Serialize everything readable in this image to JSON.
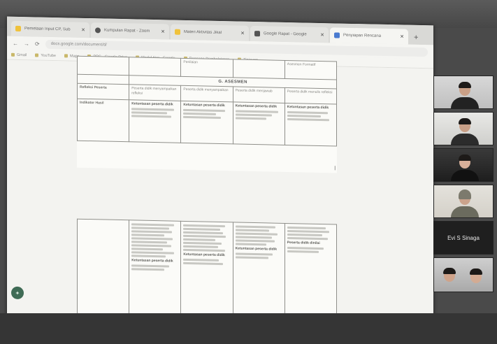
{
  "browser": {
    "tabs": [
      {
        "label": "Pemetaan Input CP, Sub",
        "color": "#f0c23b",
        "active": false
      },
      {
        "label": "Kumpulan Rapat - Zoom",
        "color": "#555555",
        "active": false
      },
      {
        "label": "Materi Aktivitas Jikal",
        "color": "#f0c23b",
        "active": false
      },
      {
        "label": "Google Rapat - Google",
        "color": "#555555",
        "active": false
      },
      {
        "label": "Penyiapan Rencana",
        "color": "#4a7bd0",
        "active": true
      }
    ],
    "new_tab": "+",
    "url": "docs.google.com/document/d/",
    "bookmarks": [
      "Gmail",
      "YouTube",
      "Maps",
      "PPG - Google Drive",
      "Modul Ajar - Google",
      "Rencana Pembelajaran",
      "Tinjauan"
    ]
  },
  "document": {
    "page1": {
      "section_head": "G. ASESMEN",
      "rows": [
        {
          "label": "",
          "cells": [
            "",
            "Penilaian",
            "",
            "",
            "Asesmen Formatif"
          ]
        },
        {
          "label": "Refleksi Peserta",
          "cells": [
            "Peserta didik menyampaikan refleksi",
            "Peserta didik menyampaikan",
            "Peserta didik menjawab",
            "Peserta didik menulis refleksi"
          ]
        },
        {
          "label": "Indikator Hasil",
          "bullet": "Ketuntasan peserta didik",
          "cells": [
            "Peserta didik mampu mengerjakan tugas",
            "Peserta didik mampu menjelaskan konsep",
            "Peserta didik mampu menyelesaikan soal",
            "Peserta didik mampu menyimpulkan"
          ]
        }
      ]
    },
    "page2": {
      "bullet_a": "Ketuntasan peserta didik",
      "bullet_b": "Peserta didik dinilai"
    }
  },
  "meeting": {
    "participant_name": "Evi S Sinaga"
  }
}
